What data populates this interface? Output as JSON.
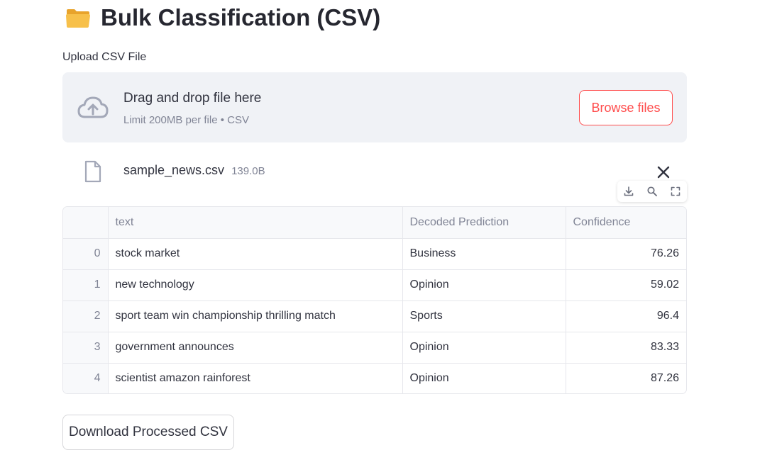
{
  "header": {
    "title": "Bulk Classification (CSV)",
    "icon": "folder-icon"
  },
  "uploader": {
    "label": "Upload CSV File",
    "drop_text": "Drag and drop file here",
    "limit_text": "Limit 200MB per file • CSV",
    "browse_label": "Browse files",
    "accent_color": "#ff4b4b"
  },
  "file": {
    "name": "sample_news.csv",
    "size": "139.0B"
  },
  "table": {
    "columns": [
      "",
      "text",
      "Decoded Prediction",
      "Confidence"
    ],
    "rows": [
      {
        "index": "0",
        "text": "stock market",
        "prediction": "Business",
        "confidence": "76.26"
      },
      {
        "index": "1",
        "text": "new technology",
        "prediction": "Opinion",
        "confidence": "59.02"
      },
      {
        "index": "2",
        "text": "sport team win championship thrilling match",
        "prediction": "Sports",
        "confidence": "96.4"
      },
      {
        "index": "3",
        "text": "government announces",
        "prediction": "Opinion",
        "confidence": "83.33"
      },
      {
        "index": "4",
        "text": "scientist amazon rainforest",
        "prediction": "Opinion",
        "confidence": "87.26"
      }
    ],
    "toolbar_icons": [
      "download-icon",
      "search-icon",
      "fullscreen-icon"
    ]
  },
  "download_button": {
    "label": "Download Processed CSV"
  }
}
